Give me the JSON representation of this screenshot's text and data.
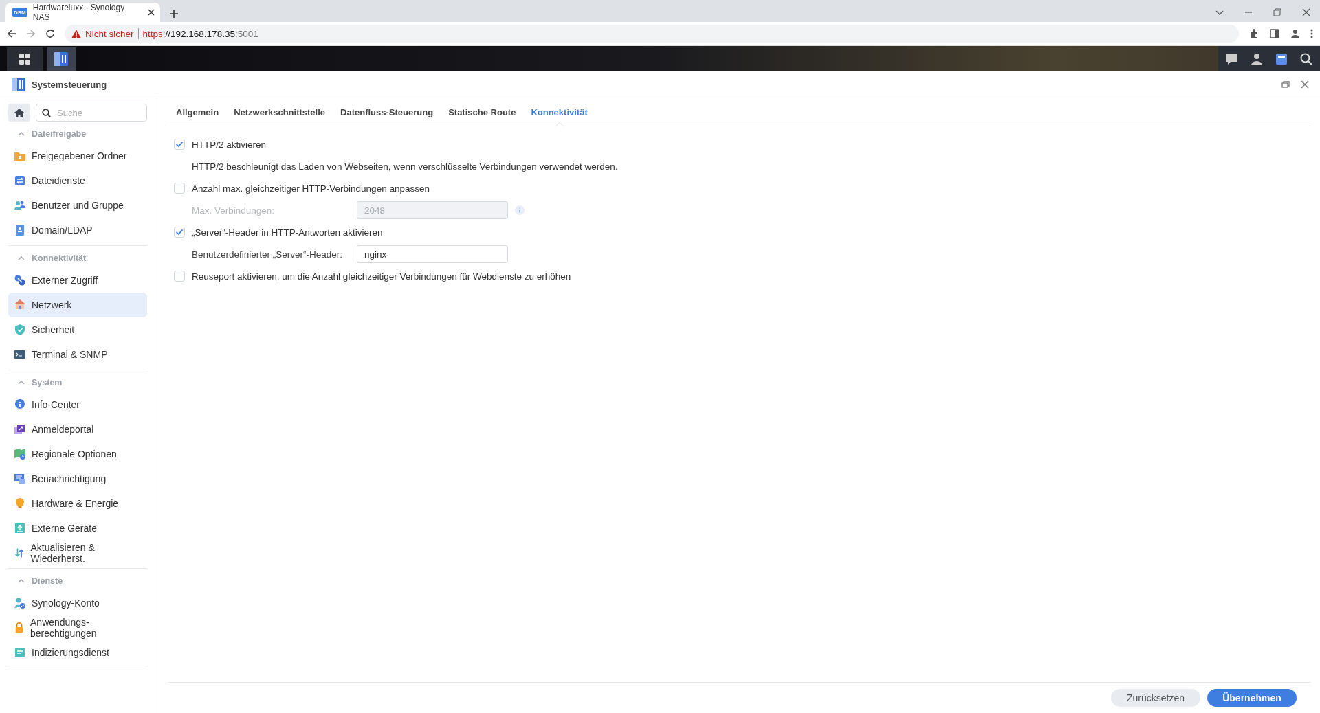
{
  "browser": {
    "tab": {
      "favicon": "DSM",
      "title": "Hardwareluxx - Synology NAS"
    },
    "address": {
      "security": "Nicht sicher",
      "scheme": "https",
      "host": "://192.168.178.35",
      "port": ":5001"
    }
  },
  "window": {
    "title": "Systemsteuerung"
  },
  "sidebar": {
    "search": {
      "placeholder": "Suche"
    },
    "groups": [
      {
        "label": "Dateifreigabe",
        "expanded": true,
        "items": [
          {
            "label": "Freigegebener Ordner",
            "selected": false
          },
          {
            "label": "Dateidienste",
            "selected": false
          },
          {
            "label": "Benutzer und Gruppe",
            "selected": false
          },
          {
            "label": "Domain/LDAP",
            "selected": false
          }
        ]
      },
      {
        "label": "Konnektivität",
        "expanded": true,
        "items": [
          {
            "label": "Externer Zugriff",
            "selected": false
          },
          {
            "label": "Netzwerk",
            "selected": true
          },
          {
            "label": "Sicherheit",
            "selected": false
          },
          {
            "label": "Terminal & SNMP",
            "selected": false
          }
        ]
      },
      {
        "label": "System",
        "expanded": true,
        "items": [
          {
            "label": "Info-Center",
            "selected": false
          },
          {
            "label": "Anmeldeportal",
            "selected": false
          },
          {
            "label": "Regionale Optionen",
            "selected": false
          },
          {
            "label": "Benachrichtigung",
            "selected": false
          },
          {
            "label": "Hardware & Energie",
            "selected": false
          },
          {
            "label": "Externe Geräte",
            "selected": false
          },
          {
            "label": "Aktualisieren & Wiederherst.",
            "selected": false
          }
        ]
      },
      {
        "label": "Dienste",
        "expanded": true,
        "items": [
          {
            "label": "Synology-Konto",
            "selected": false
          },
          {
            "label": "Anwendungs-berechtigungen",
            "selected": false
          },
          {
            "label": "Indizierungsdienst",
            "selected": false
          }
        ]
      }
    ]
  },
  "tabs": [
    {
      "label": "Allgemein",
      "selected": false
    },
    {
      "label": "Netzwerkschnittstelle",
      "selected": false
    },
    {
      "label": "Datenfluss-Steuerung",
      "selected": false
    },
    {
      "label": "Statische Route",
      "selected": false
    },
    {
      "label": "Konnektivität",
      "selected": true
    }
  ],
  "settings": [
    {
      "kind": "checkbox",
      "label": "HTTP/2 aktivieren",
      "checked": true
    },
    {
      "kind": "note",
      "text": "HTTP/2 beschleunigt das Laden von Webseiten, wenn verschlüsselte Verbindungen verwendet werden."
    },
    {
      "kind": "checkbox",
      "label": "Anzahl max. gleichzeitiger HTTP-Verbindungen anpassen",
      "checked": false
    },
    {
      "kind": "field",
      "label": "Max. Verbindungen:",
      "value": "2048",
      "disabled": true,
      "info": true
    },
    {
      "kind": "checkbox",
      "label": "„Server“-Header in HTTP-Antworten aktivieren",
      "checked": true
    },
    {
      "kind": "field",
      "label": "Benutzerdefinierter „Server“-Header:",
      "value": "nginx",
      "disabled": false,
      "info": false
    },
    {
      "kind": "checkbox",
      "label": "Reuseport aktivieren, um die Anzahl gleichzeitiger Verbindungen für Webdienste zu erhöhen",
      "checked": false
    }
  ],
  "buttons": [
    {
      "label": "Zurücksetzen",
      "primary": false
    },
    {
      "label": "Übernehmen",
      "primary": true
    }
  ]
}
